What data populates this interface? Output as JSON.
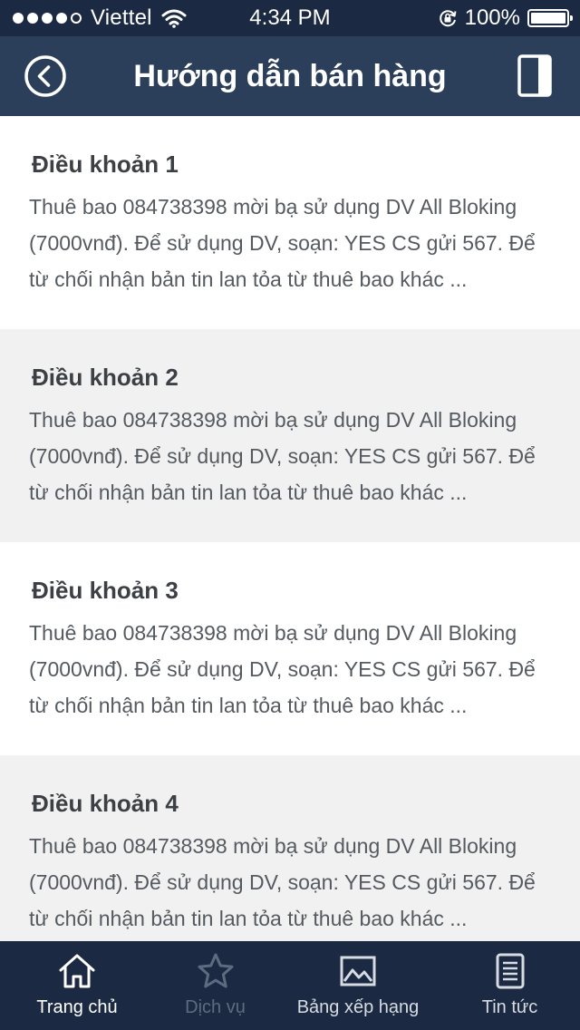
{
  "status_bar": {
    "carrier": "Viettel",
    "time": "4:34 PM",
    "battery": "100%",
    "signal_bars_filled": 4,
    "signal_bars_total": 5
  },
  "nav": {
    "title": "Hướng dẫn bán hàng",
    "back_icon": "back-circle-icon",
    "right_icon": "book-icon"
  },
  "articles": [
    {
      "title": "Điều khoản 1",
      "body": "Thuê bao 084738398 mời bạ sử dụng DV All Bloking (7000vnđ). Để sử dụng DV, soạn: YES CS gửi 567. Để từ chối nhận bản tin lan tỏa từ thuê bao khác ..."
    },
    {
      "title": "Điều khoản 2",
      "body": "Thuê bao 084738398 mời bạ sử dụng DV All Bloking (7000vnđ). Để sử dụng DV, soạn: YES CS gửi 567. Để từ chối nhận bản tin lan tỏa từ thuê bao khác ..."
    },
    {
      "title": "Điều khoản 3",
      "body": "Thuê bao 084738398 mời bạ sử dụng DV All Bloking (7000vnđ). Để sử dụng DV, soạn: YES CS gửi 567. Để từ chối nhận bản tin lan tỏa từ thuê bao khác ..."
    },
    {
      "title": "Điều khoản 4",
      "body": "Thuê bao 084738398 mời bạ sử dụng DV All Bloking (7000vnđ). Để sử dụng DV, soạn: YES CS gửi 567. Để từ chối nhận bản tin lan tỏa từ thuê bao khác ..."
    }
  ],
  "tabs": [
    {
      "label": "Trang chủ",
      "icon": "home-icon",
      "state": "active"
    },
    {
      "label": "Dịch vụ",
      "icon": "star-icon",
      "state": "inactive"
    },
    {
      "label": "Bảng xếp hạng",
      "icon": "chart-image-icon",
      "state": "normal"
    },
    {
      "label": "Tin tức",
      "icon": "news-icon",
      "state": "normal"
    }
  ],
  "colors": {
    "status_bar_bg": "#1b2a42",
    "nav_bg": "#2b3f5a",
    "tab_bar_bg": "#1b2a42",
    "alt_row_bg": "#f1f1f1",
    "title_text": "#3c3f44",
    "body_text": "#555a60",
    "tab_active": "#ffffff",
    "tab_inactive": "#5d6b80"
  }
}
